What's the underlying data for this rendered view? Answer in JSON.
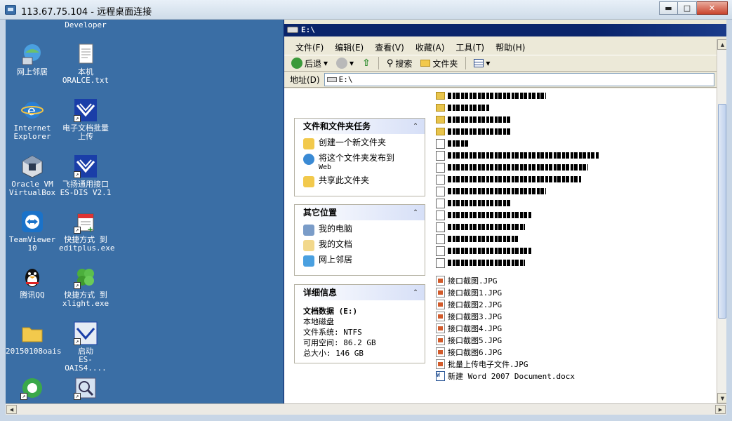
{
  "window": {
    "title": "113.67.75.104 - 远程桌面连接"
  },
  "desktop_icons": [
    {
      "name": "developer",
      "label": "Developer",
      "icon": "app-icon"
    },
    {
      "name": "network-places",
      "label": "网上邻居",
      "icon": "network-icon"
    },
    {
      "name": "oralce-txt",
      "label": "本机\nORALCE.txt",
      "icon": "text-file-icon"
    },
    {
      "name": "internet-explorer",
      "label": "Internet\nExplorer",
      "icon": "ie-icon"
    },
    {
      "name": "batch-upload",
      "label": "电子文档批量\n上传",
      "icon": "app-shortcut-icon"
    },
    {
      "name": "virtualbox",
      "label": "Oracle VM\nVirtualBox",
      "icon": "virtualbox-icon"
    },
    {
      "name": "es-dis",
      "label": "飞扬通用接口\nES-DIS V2.1",
      "icon": "app-shortcut-icon"
    },
    {
      "name": "teamviewer",
      "label": "TeamViewer\n10",
      "icon": "teamviewer-icon"
    },
    {
      "name": "editplus",
      "label": "快捷方式 到\neditplus.exe",
      "icon": "editplus-icon"
    },
    {
      "name": "qq",
      "label": "腾讯QQ",
      "icon": "qq-icon"
    },
    {
      "name": "xlight",
      "label": "快捷方式 到\nxlight.exe",
      "icon": "xlight-icon"
    },
    {
      "name": "folder-20150108",
      "label": "20150108oais",
      "icon": "folder-icon"
    },
    {
      "name": "es-oais",
      "label": "启动\nES-OAIS4....",
      "icon": "app-shortcut-icon"
    }
  ],
  "explorer": {
    "title": "E:\\",
    "menu": [
      "文件(F)",
      "编辑(E)",
      "查看(V)",
      "收藏(A)",
      "工具(T)",
      "帮助(H)"
    ],
    "toolbar": {
      "back": "后退",
      "search": "搜索",
      "folders": "文件夹"
    },
    "address": {
      "label": "地址(D)",
      "value": "E:\\"
    },
    "tasks": {
      "title": "文件和文件夹任务",
      "items": [
        "创建一个新文件夹",
        "将这个文件夹发布到",
        "Web",
        "共享此文件夹"
      ]
    },
    "places": {
      "title": "其它位置",
      "items": [
        "我的电脑",
        "我的文档",
        "网上邻居"
      ]
    },
    "details": {
      "title": "详细信息",
      "name": "文档数据 (E:)",
      "type": "本地磁盘",
      "fs": "文件系统: NTFS",
      "free": "可用空间: 86.2 GB",
      "total": "总大小: 146 GB"
    },
    "files": [
      "接口截图.JPG",
      "接口截图1.JPG",
      "接口截图2.JPG",
      "接口截图3.JPG",
      "接口截图4.JPG",
      "接口截图5.JPG",
      "接口截图6.JPG",
      "批量上传电子文件.JPG",
      "新建 Word 2007 Document.docx"
    ]
  },
  "colors": {
    "desktop": "#3a6ea5",
    "explorer_title": "#0a246a"
  }
}
